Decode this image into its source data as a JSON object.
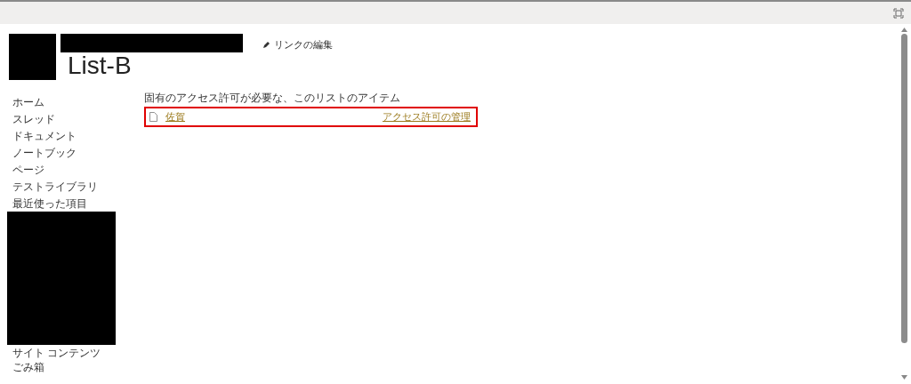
{
  "header": {
    "title": "List-B",
    "edit_links": "リンクの編集"
  },
  "nav": {
    "items": [
      {
        "label": "ホーム"
      },
      {
        "label": "スレッド"
      },
      {
        "label": "ドキュメント"
      },
      {
        "label": "ノートブック"
      },
      {
        "label": "ページ"
      },
      {
        "label": "テストライブラリ"
      },
      {
        "label": "最近使った項目"
      }
    ],
    "bottom_items": [
      {
        "label": "サイト コンテンツ"
      },
      {
        "label": "ごみ箱"
      }
    ]
  },
  "main": {
    "caption": "固有のアクセス許可が必要な、このリストのアイテム",
    "items": [
      {
        "name": "佐賀",
        "action": "アクセス許可の管理"
      }
    ]
  }
}
